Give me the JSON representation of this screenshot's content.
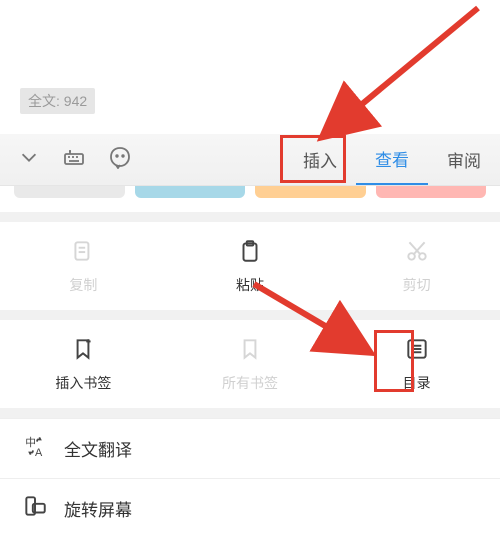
{
  "char_count": "全文: 942",
  "tabs": {
    "insert": "插入",
    "view": "查看",
    "review": "审阅"
  },
  "row1": {
    "copy": "复制",
    "paste": "粘贴",
    "cut": "剪切"
  },
  "row2": {
    "insert_bookmark": "插入书签",
    "all_bookmarks": "所有书签",
    "contents": "目录"
  },
  "list": {
    "translate": "全文翻译",
    "rotate": "旋转屏幕"
  },
  "colors": [
    "#e9e9e9",
    "#a7d8e8",
    "#ffcf93",
    "#ffb7b3"
  ]
}
